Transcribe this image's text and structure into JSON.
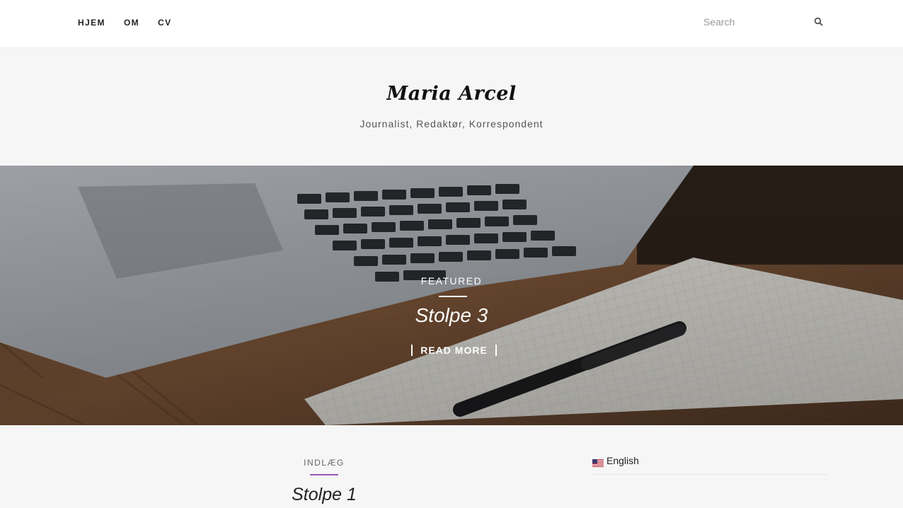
{
  "nav": {
    "items": [
      {
        "label": "HJEM"
      },
      {
        "label": "OM"
      },
      {
        "label": "CV"
      }
    ]
  },
  "search": {
    "placeholder": "Search",
    "icon": "search-icon"
  },
  "header": {
    "site_title": "Maria Arcel",
    "tagline": "Journalist, Redaktør, Korrespondent"
  },
  "hero": {
    "kicker": "FEATURED",
    "title": "Stolpe 3",
    "read_more": "READ MORE"
  },
  "post": {
    "category": "INDLÆG",
    "title": "Stolpe 1"
  },
  "language": {
    "label": "English",
    "icon": "us-flag-icon"
  },
  "colors": {
    "accent": "#9b59b6",
    "topbar": "#ffffff",
    "page_bg": "#f6f6f6"
  }
}
